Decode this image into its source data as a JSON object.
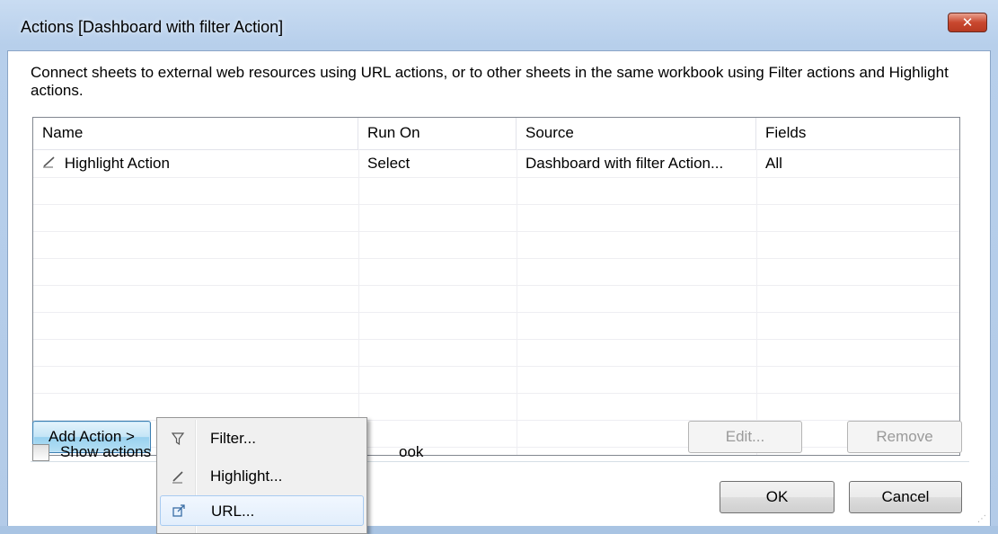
{
  "window": {
    "title": "Actions [Dashboard with filter Action]",
    "close_glyph": "✕"
  },
  "description": "Connect sheets to external web resources using URL actions, or to other sheets in the same workbook using Filter actions and Highlight actions.",
  "table": {
    "columns": [
      "Name",
      "Run On",
      "Source",
      "Fields"
    ],
    "rows": [
      {
        "icon": "highlight-pencil-icon",
        "name": "Highlight Action",
        "run_on": "Select",
        "source": "Dashboard with filter Action...",
        "fields": "All"
      }
    ]
  },
  "buttons": {
    "add_action": "Add Action >",
    "edit": "Edit...",
    "remove": "Remove",
    "ok": "OK",
    "cancel": "Cancel"
  },
  "checkbox": {
    "label_start": "Show actions",
    "label_end": "ook",
    "checked": false
  },
  "menu": {
    "items": [
      {
        "icon": "filter-funnel-icon",
        "label": "Filter..."
      },
      {
        "icon": "highlight-pencil-icon",
        "label": "Highlight..."
      },
      {
        "icon": "url-link-icon",
        "label": "URL..."
      }
    ],
    "hovered_index": 2
  }
}
